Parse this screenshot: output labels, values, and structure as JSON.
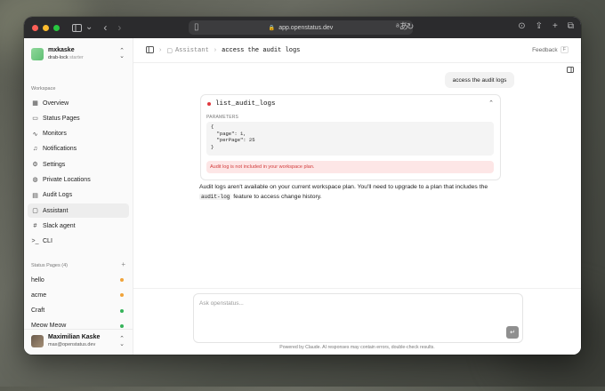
{
  "browser": {
    "url": "app.openstatus.dev",
    "traffic_colors": [
      "#fe5f57",
      "#febc2e",
      "#28c840"
    ]
  },
  "sidebar": {
    "team": {
      "name": "mxkaske",
      "slug": "drab-lock",
      "plan": "starter"
    },
    "workspace_label": "Workspace",
    "nav_items": [
      {
        "label": "Overview",
        "icon": "grid-icon"
      },
      {
        "label": "Status Pages",
        "icon": "window-icon"
      },
      {
        "label": "Monitors",
        "icon": "activity-icon"
      },
      {
        "label": "Notifications",
        "icon": "bell-icon"
      },
      {
        "label": "Settings",
        "icon": "gear-icon"
      },
      {
        "label": "Private Locations",
        "icon": "globe-icon"
      },
      {
        "label": "Audit Logs",
        "icon": "document-icon"
      },
      {
        "label": "Assistant",
        "icon": "message-icon",
        "active": true
      },
      {
        "label": "Slack agent",
        "icon": "slack-icon"
      },
      {
        "label": "CLI",
        "icon": "terminal-icon"
      }
    ],
    "status_pages_label": "Status Pages",
    "status_pages_count": "(4)",
    "status_pages": [
      {
        "label": "hello",
        "status_color": "#f0a33a"
      },
      {
        "label": "acme",
        "status_color": "#f0a33a"
      },
      {
        "label": "Craft",
        "status_color": "#36b35a"
      },
      {
        "label": "Meow Meow",
        "status_color": "#36b35a"
      }
    ],
    "user": {
      "name": "Maximilian Kaske",
      "email": "max@openstatus.dev"
    }
  },
  "header": {
    "breadcrumb_section": "Assistant",
    "breadcrumb_page": "access the audit logs",
    "feedback_label": "Feedback",
    "feedback_shortcut": "F"
  },
  "chat": {
    "user_message": "access the audit logs",
    "tool_call": {
      "name": "list_audit_logs",
      "params_label": "PARAMETERS",
      "params_lines": [
        "{",
        "  \"page\": 1,",
        "  \"perPage\": 25",
        "}"
      ],
      "error": "Audit log is not included in your workspace plan."
    },
    "answer_part1": "Audit logs aren't available on your current workspace plan. You'll need to upgrade to a plan that includes the",
    "answer_code": "audit-log",
    "answer_part2": "feature to access change history."
  },
  "composer": {
    "placeholder": "Ask openstatus...",
    "disclaimer": "Powered by Claude. AI responses may contain errors, double-check results."
  }
}
